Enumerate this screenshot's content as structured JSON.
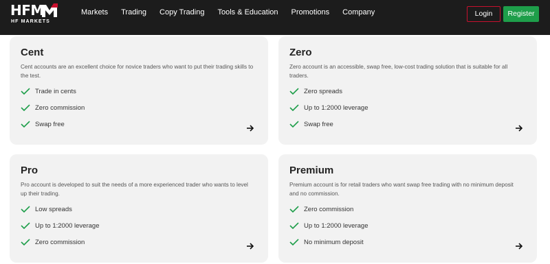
{
  "brand": {
    "name": "HFM",
    "tagline": "HF MARKETS",
    "accent": "#c8102e"
  },
  "nav": {
    "items": [
      "Markets",
      "Trading",
      "Copy Trading",
      "Tools & Education",
      "Promotions",
      "Company"
    ]
  },
  "auth": {
    "login": "Login",
    "register": "Register",
    "register_color": "#1e9e4a"
  },
  "accounts": [
    {
      "title": "Cent",
      "description": "Cent accounts are an excellent choice for novice traders who want to put their trading skills to the test.",
      "features": [
        "Trade in cents",
        "Zero commission",
        "Swap free"
      ],
      "arrow_icon": "arrow-right-icon"
    },
    {
      "title": "Zero",
      "description": "Zero account is an accessible, swap free, low-cost trading solution that is suitable for all traders.",
      "features": [
        "Zero spreads",
        "Up to 1:2000 leverage",
        "Swap free"
      ],
      "arrow_icon": "arrow-right-icon"
    },
    {
      "title": "Pro",
      "description": "Pro account is developed to suit the needs of a more experienced trader who wants to level up their trading.",
      "features": [
        "Low spreads",
        "Up to 1:2000 leverage",
        "Zero commission"
      ],
      "arrow_icon": "arrow-right-icon"
    },
    {
      "title": "Premium",
      "description": "Premium account is for retail traders who want swap free trading with no minimum deposit and no commission.",
      "features": [
        "Zero commission",
        "Up to 1:2000 leverage",
        "No minimum deposit"
      ],
      "arrow_icon": "arrow-right-icon"
    }
  ],
  "check_color": "#1e9e4a"
}
